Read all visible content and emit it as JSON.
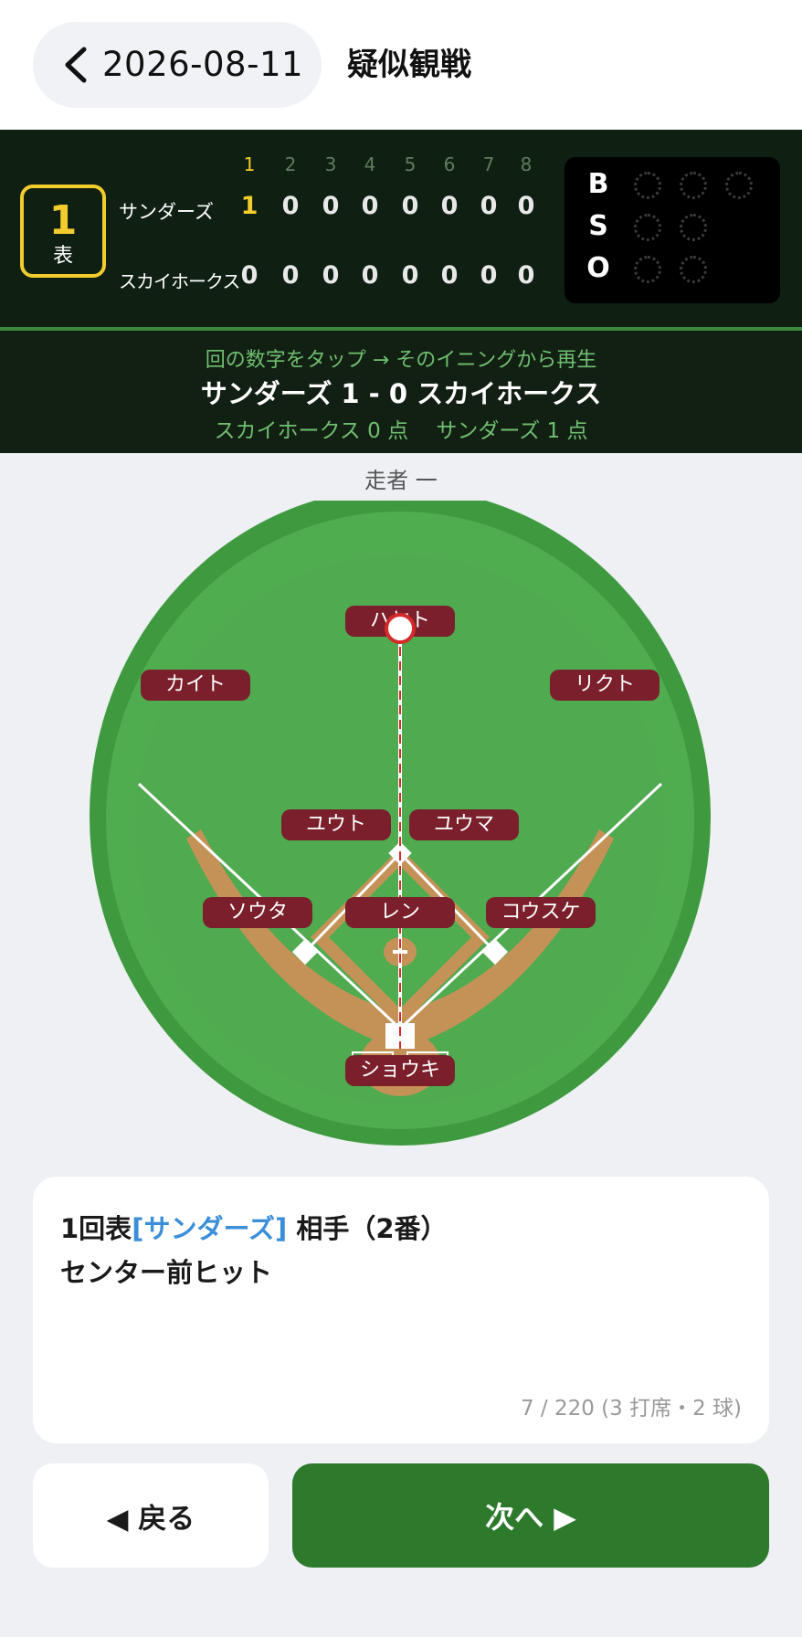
{
  "header": {
    "date": "2026-08-11",
    "title": "疑似観戦"
  },
  "scoreboard": {
    "inning_number": "1",
    "inning_half": "表",
    "innings": [
      "1",
      "2",
      "3",
      "4",
      "5",
      "6",
      "7",
      "8"
    ],
    "current_inning_index": 0,
    "teams": [
      {
        "name": "サンダーズ",
        "scores": [
          "1",
          "0",
          "0",
          "0",
          "0",
          "0",
          "0",
          "0"
        ]
      },
      {
        "name": "スカイホークス",
        "scores": [
          "0",
          "0",
          "0",
          "0",
          "0",
          "0",
          "0",
          "0"
        ]
      }
    ],
    "bso": {
      "b_label": "B",
      "s_label": "S",
      "o_label": "O",
      "balls": 0,
      "strikes": 0,
      "outs": 0
    }
  },
  "info": {
    "hint": "回の数字をタップ → そのイニングから再生",
    "matchup": "サンダーズ 1 - 0 スカイホークス",
    "points": "スカイホークス 0 点　 サンダーズ 1 点"
  },
  "field": {
    "runner_label": "走者 一",
    "players": [
      {
        "name": "ハヤト",
        "position": "CF"
      },
      {
        "name": "カイト",
        "position": "LF"
      },
      {
        "name": "リクト",
        "position": "RF"
      },
      {
        "name": "ユウト",
        "position": "SS"
      },
      {
        "name": "ユウマ",
        "position": "2B"
      },
      {
        "name": "ソウタ",
        "position": "3B"
      },
      {
        "name": "レン",
        "position": "P"
      },
      {
        "name": "コウスケ",
        "position": "1B"
      },
      {
        "name": "ショウキ",
        "position": "C"
      }
    ]
  },
  "play": {
    "prefix": "1回表",
    "team": "[サンダーズ]",
    "suffix": " 相手（2番）",
    "result": "センター前ヒット",
    "progress": "7 / 220 (3 打席・2 球)"
  },
  "nav": {
    "prev_label": "◀ 戻る",
    "next_label": "次へ ▶"
  },
  "colors": {
    "accent_green": "#2d7a2d",
    "player_tag": "#7a1f2b",
    "inning_highlight": "#f2cc2c",
    "team_link": "#3a8fd8"
  }
}
